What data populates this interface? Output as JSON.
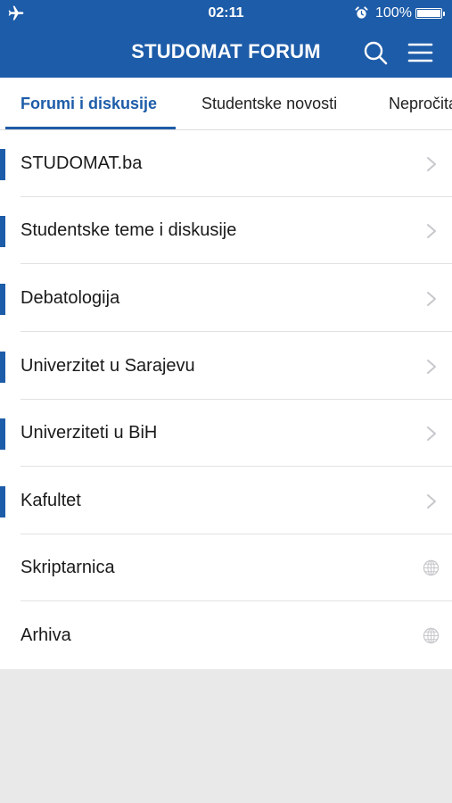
{
  "status_bar": {
    "time": "02:11",
    "battery_text": "100%",
    "icons": [
      "airplane-icon",
      "alarm-icon",
      "battery-icon"
    ]
  },
  "header": {
    "title": "STUDOMAT FORUM",
    "icons": [
      "search-icon",
      "menu-icon"
    ]
  },
  "tabs": [
    {
      "label": "Forumi i diskusije",
      "active": true
    },
    {
      "label": "Studentske novosti",
      "active": false
    },
    {
      "label": "Nepročitano",
      "active": false
    }
  ],
  "forums": [
    {
      "label": "STUDOMAT.ba",
      "accent": true,
      "icon": "chevron-right-icon"
    },
    {
      "label": "Studentske teme i diskusije",
      "accent": true,
      "icon": "chevron-right-icon"
    },
    {
      "label": "Debatologija",
      "accent": true,
      "icon": "chevron-right-icon"
    },
    {
      "label": "Univerzitet u Sarajevu",
      "accent": true,
      "icon": "chevron-right-icon"
    },
    {
      "label": "Univerziteti u BiH",
      "accent": true,
      "icon": "chevron-right-icon"
    },
    {
      "label": "Kafultet",
      "accent": true,
      "icon": "chevron-right-icon"
    },
    {
      "label": "Skriptarnica",
      "accent": false,
      "icon": "globe-icon"
    },
    {
      "label": "Arhiva",
      "accent": false,
      "icon": "globe-icon"
    }
  ],
  "colors": {
    "brand": "#1d5ca8",
    "background": "#e9e9e9",
    "list_background": "#ffffff",
    "chevron": "#c7c7cc"
  }
}
